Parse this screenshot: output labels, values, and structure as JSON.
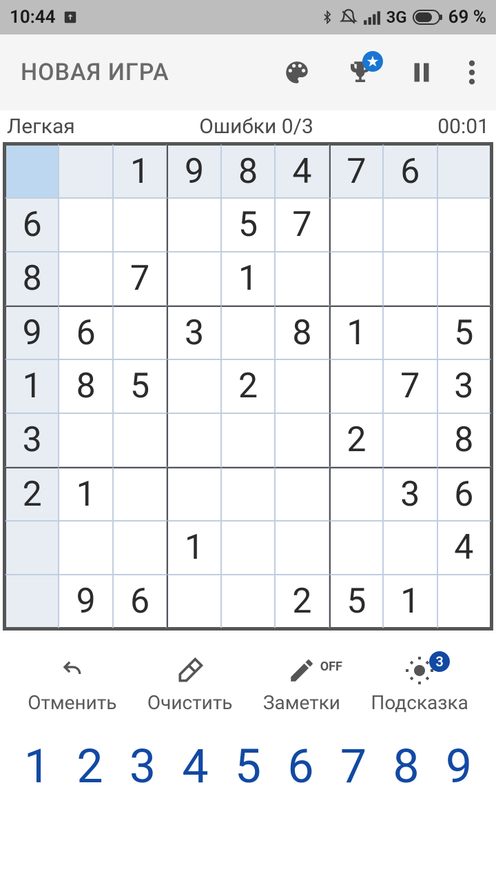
{
  "status": {
    "time": "10:44",
    "network": "3G",
    "battery": "69 %"
  },
  "appbar": {
    "title": "НОВАЯ ИГРА"
  },
  "info": {
    "difficulty": "Легкая",
    "mistakes": "Ошибки 0/3",
    "timer": "00:01"
  },
  "board": {
    "selected": [
      0,
      0
    ],
    "rows": [
      [
        {
          "v": "",
          "g": true
        },
        {
          "v": "",
          "g": true
        },
        {
          "v": "1",
          "g": true
        },
        {
          "v": "9",
          "g": true
        },
        {
          "v": "8",
          "g": true
        },
        {
          "v": "4",
          "g": true
        },
        {
          "v": "7",
          "g": true
        },
        {
          "v": "6",
          "g": true
        },
        {
          "v": "",
          "g": true
        }
      ],
      [
        {
          "v": "6",
          "g": true
        },
        {
          "v": "",
          "g": false
        },
        {
          "v": "",
          "g": false
        },
        {
          "v": "",
          "g": false
        },
        {
          "v": "5",
          "g": false
        },
        {
          "v": "7",
          "g": false
        },
        {
          "v": "",
          "g": false
        },
        {
          "v": "",
          "g": false
        },
        {
          "v": "",
          "g": false
        }
      ],
      [
        {
          "v": "8",
          "g": true
        },
        {
          "v": "",
          "g": false
        },
        {
          "v": "7",
          "g": false
        },
        {
          "v": "",
          "g": false
        },
        {
          "v": "1",
          "g": false
        },
        {
          "v": "",
          "g": false
        },
        {
          "v": "",
          "g": false
        },
        {
          "v": "",
          "g": false
        },
        {
          "v": "",
          "g": false
        }
      ],
      [
        {
          "v": "9",
          "g": true
        },
        {
          "v": "6",
          "g": false
        },
        {
          "v": "",
          "g": false
        },
        {
          "v": "3",
          "g": false
        },
        {
          "v": "",
          "g": false
        },
        {
          "v": "8",
          "g": false
        },
        {
          "v": "1",
          "g": false
        },
        {
          "v": "",
          "g": false
        },
        {
          "v": "5",
          "g": false
        }
      ],
      [
        {
          "v": "1",
          "g": true
        },
        {
          "v": "8",
          "g": false
        },
        {
          "v": "5",
          "g": false
        },
        {
          "v": "",
          "g": false
        },
        {
          "v": "2",
          "g": false
        },
        {
          "v": "",
          "g": false
        },
        {
          "v": "",
          "g": false
        },
        {
          "v": "7",
          "g": false
        },
        {
          "v": "3",
          "g": false
        }
      ],
      [
        {
          "v": "3",
          "g": true
        },
        {
          "v": "",
          "g": false
        },
        {
          "v": "",
          "g": false
        },
        {
          "v": "",
          "g": false
        },
        {
          "v": "",
          "g": false
        },
        {
          "v": "",
          "g": false
        },
        {
          "v": "2",
          "g": false
        },
        {
          "v": "",
          "g": false
        },
        {
          "v": "8",
          "g": false
        }
      ],
      [
        {
          "v": "2",
          "g": true
        },
        {
          "v": "1",
          "g": false
        },
        {
          "v": "",
          "g": false
        },
        {
          "v": "",
          "g": false
        },
        {
          "v": "",
          "g": false
        },
        {
          "v": "",
          "g": false
        },
        {
          "v": "",
          "g": false
        },
        {
          "v": "3",
          "g": false
        },
        {
          "v": "6",
          "g": false
        }
      ],
      [
        {
          "v": "",
          "g": true
        },
        {
          "v": "",
          "g": false
        },
        {
          "v": "",
          "g": false
        },
        {
          "v": "1",
          "g": false
        },
        {
          "v": "",
          "g": false
        },
        {
          "v": "",
          "g": false
        },
        {
          "v": "",
          "g": false
        },
        {
          "v": "",
          "g": false
        },
        {
          "v": "4",
          "g": false
        }
      ],
      [
        {
          "v": "",
          "g": true
        },
        {
          "v": "9",
          "g": false
        },
        {
          "v": "6",
          "g": false
        },
        {
          "v": "",
          "g": false
        },
        {
          "v": "",
          "g": false
        },
        {
          "v": "2",
          "g": false
        },
        {
          "v": "5",
          "g": false
        },
        {
          "v": "1",
          "g": false
        },
        {
          "v": "",
          "g": false
        }
      ]
    ]
  },
  "tools": {
    "undo": "Отменить",
    "erase": "Очистить",
    "notes": "Заметки",
    "notes_state": "OFF",
    "hint": "Подсказка",
    "hint_count": "3"
  },
  "numpad": [
    "1",
    "2",
    "3",
    "4",
    "5",
    "6",
    "7",
    "8",
    "9"
  ]
}
